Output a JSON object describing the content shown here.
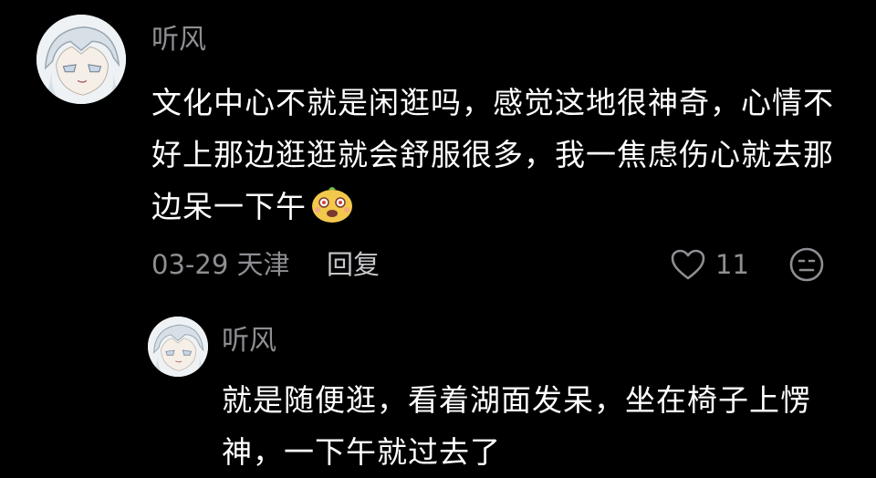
{
  "comment": {
    "username": "听风",
    "text": "文化中心不就是闲逛吗，感觉这地很神奇，心情不好上那边逛逛就会舒服很多，我一焦虑伤心就去那边呆一下午",
    "emoji_icon": "yellow-bean-face-emoji",
    "meta": "03-29 天津",
    "reply_label": "回复",
    "like_count": "11",
    "like_icon": "heart-outline-icon",
    "dislike_icon": "unhappy-face-icon"
  },
  "reply": {
    "username": "听风",
    "text": "就是随便逛，看着湖面发呆，坐在椅子上愣神，一下午就过去了"
  },
  "colors": {
    "background": "#000000",
    "text_primary": "#ffffff",
    "text_secondary": "#8e8e93",
    "reply_link": "#c7c7cc",
    "emoji_face": "#f2c94c"
  }
}
